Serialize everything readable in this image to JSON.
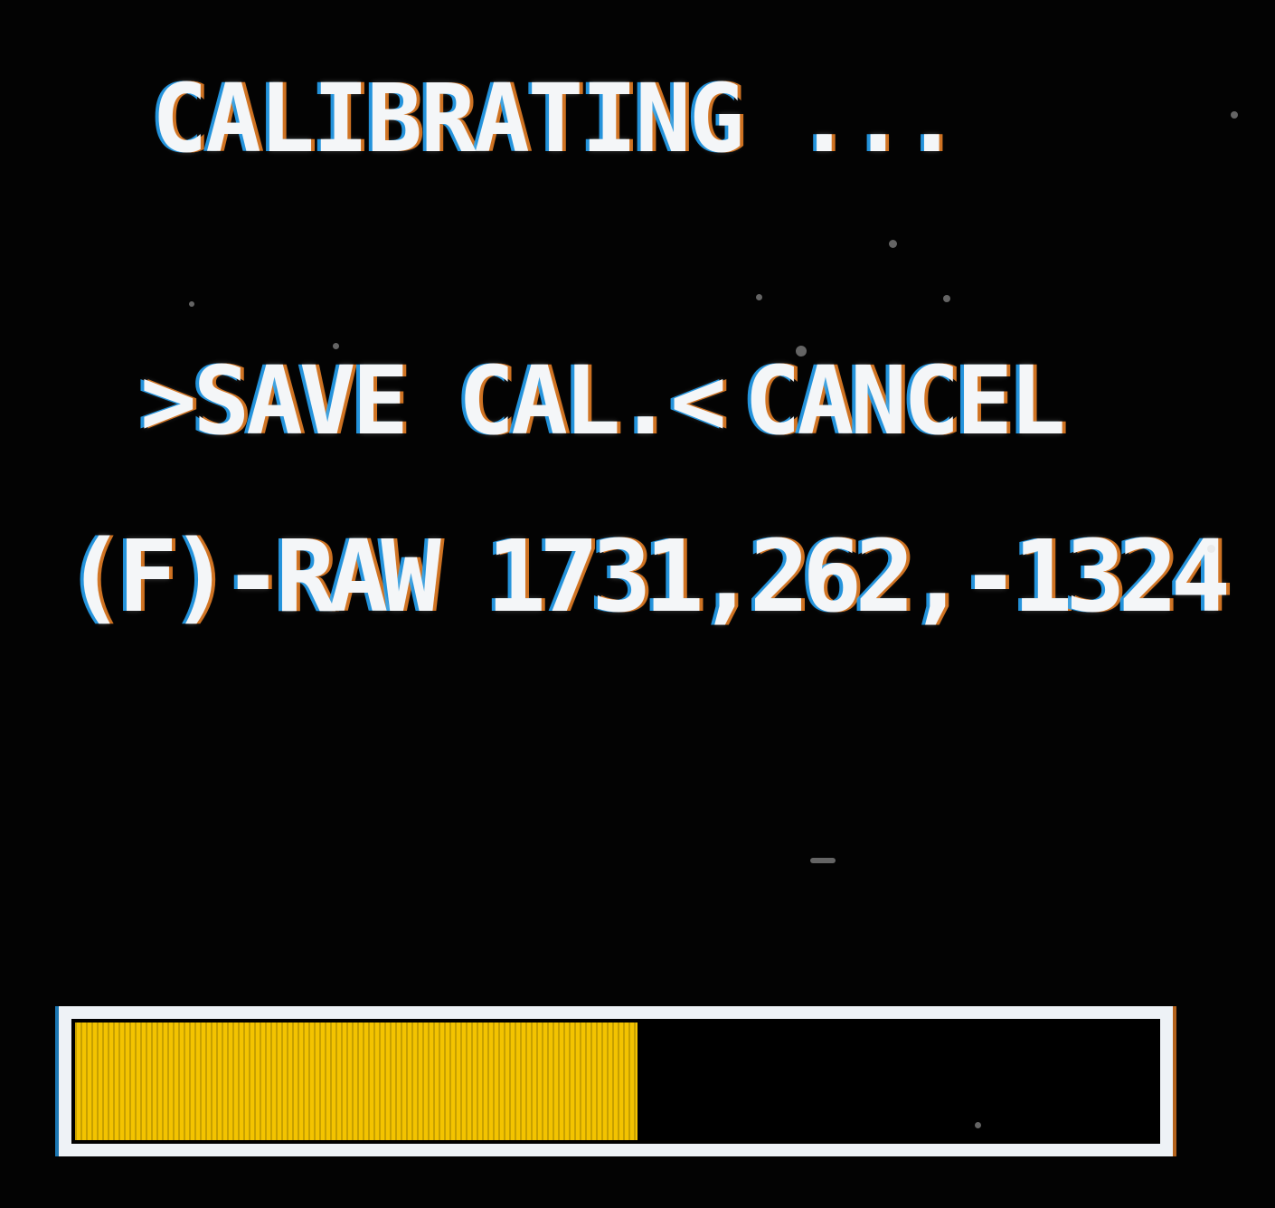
{
  "screen": {
    "title": "CALIBRATING ...",
    "menu": {
      "save_label": ">SAVE CAL.<",
      "cancel_label": "CANCEL",
      "selected": "save"
    },
    "raw_readout": "(F)-RAW 1731,262,-1324",
    "progress": {
      "value": 0.52,
      "fill_color": "#f3c300",
      "border_color": "#eef2f6"
    }
  }
}
